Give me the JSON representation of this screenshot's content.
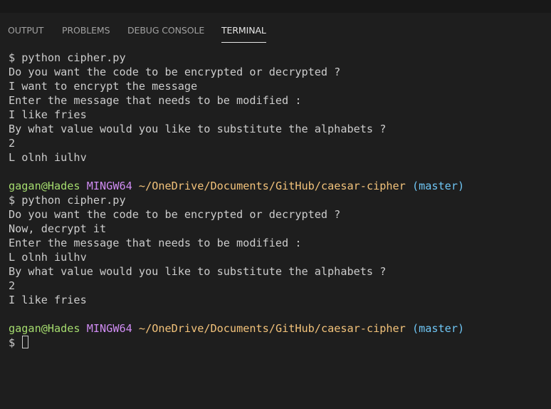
{
  "tabs": [
    {
      "label": "OUTPUT"
    },
    {
      "label": "PROBLEMS"
    },
    {
      "label": "DEBUG CONSOLE"
    },
    {
      "label": "TERMINAL"
    }
  ],
  "active_tab": "TERMINAL",
  "terminal": {
    "lines": [
      "$ python cipher.py",
      "Do you want the code to be encrypted or decrypted ?",
      "I want to encrypt the message",
      "Enter the message that needs to be modified :",
      "I like fries",
      "By what value would you like to substitute the alphabets ?",
      "2",
      "L olnh iulhv",
      "",
      "$ python cipher.py",
      "Do you want the code to be encrypted or decrypted ?",
      "Now, decrypt it",
      "Enter the message that needs to be modified :",
      "L olnh iulhv",
      "By what value would you like to substitute the alphabets ?",
      "2",
      "I like fries",
      "",
      "$"
    ],
    "prompt": {
      "user_host": "gagan@Hades",
      "shell": "MINGW64",
      "path": "~/OneDrive/Documents/GitHub/caesar-cipher",
      "branch": "(master)"
    }
  },
  "colors": {
    "background": "#1e1e1e",
    "text": "#cccccc",
    "user_host": "#a5dc6e",
    "shell": "#cf8cf2",
    "path": "#f2c27a",
    "branch": "#6fc6f5"
  }
}
